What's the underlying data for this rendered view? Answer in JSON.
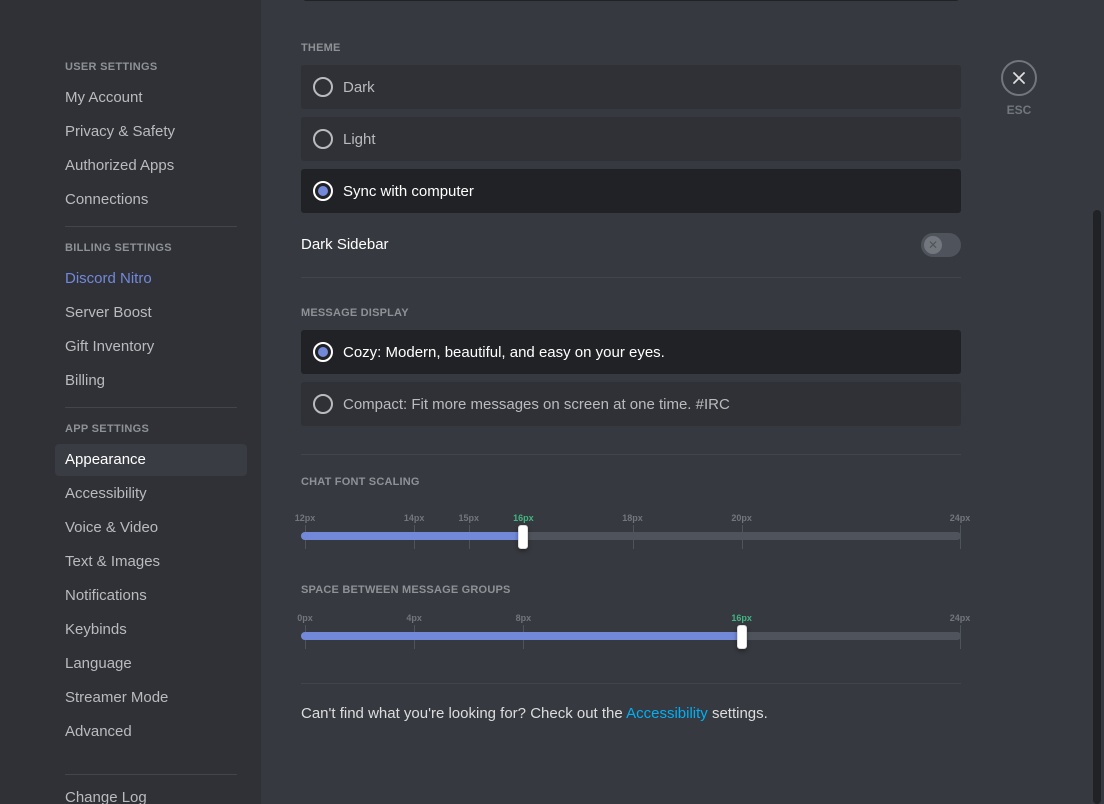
{
  "sidebar": {
    "user_settings_header": "USER SETTINGS",
    "user_items": [
      "My Account",
      "Privacy & Safety",
      "Authorized Apps",
      "Connections"
    ],
    "billing_settings_header": "BILLING SETTINGS",
    "billing_items": [
      "Discord Nitro",
      "Server Boost",
      "Gift Inventory",
      "Billing"
    ],
    "app_settings_header": "APP SETTINGS",
    "app_items": [
      "Appearance",
      "Accessibility",
      "Voice & Video",
      "Text & Images",
      "Notifications",
      "Keybinds",
      "Language",
      "Streamer Mode",
      "Advanced"
    ],
    "selected_item": "Appearance",
    "change_log": "Change Log"
  },
  "theme": {
    "label": "THEME",
    "options": [
      "Dark",
      "Light",
      "Sync with computer"
    ],
    "selected": "Sync with computer"
  },
  "dark_sidebar": {
    "label": "Dark Sidebar",
    "enabled": false
  },
  "message_display": {
    "label": "MESSAGE DISPLAY",
    "options": [
      "Cozy: Modern, beautiful, and easy on your eyes.",
      "Compact: Fit more messages on screen at one time. #IRC"
    ],
    "selected": "Cozy: Modern, beautiful, and easy on your eyes."
  },
  "chat_font_scaling": {
    "label": "CHAT FONT SCALING",
    "ticks": [
      "12px",
      "14px",
      "15px",
      "16px",
      "18px",
      "20px",
      "24px"
    ],
    "tick_values": [
      12,
      14,
      15,
      16,
      18,
      20,
      24
    ],
    "min": 12,
    "max": 24,
    "value": 16,
    "value_label": "16px"
  },
  "message_spacing": {
    "label": "SPACE BETWEEN MESSAGE GROUPS",
    "ticks": [
      "0px",
      "4px",
      "8px",
      "16px",
      "24px"
    ],
    "tick_values": [
      0,
      4,
      8,
      16,
      24
    ],
    "min": 0,
    "max": 24,
    "value": 16,
    "value_label": "16px"
  },
  "footer": {
    "prefix": "Can't find what you're looking for? Check out the",
    "link": "Accessibility",
    "suffix": "settings."
  },
  "close": {
    "label": "ESC",
    "icon": "close-icon"
  },
  "colors": {
    "accent": "#7289da",
    "link": "#00b0f4",
    "active_tick": "#43b581"
  }
}
